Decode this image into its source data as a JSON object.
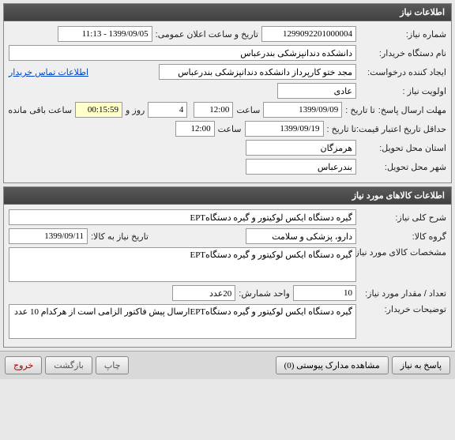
{
  "panel1": {
    "title": "اطلاعات نیاز",
    "reqno_label": "شماره نیاز:",
    "reqno": "1299092201000004",
    "announce_label": "تاریخ و ساعت اعلان عمومی:",
    "announce_value": "1399/09/05 - 11:13",
    "buyer_label": "نام دستگاه خریدار:",
    "buyer": "دانشکده دندانپزشکی بندرعباس",
    "requester_label": "ایجاد کننده درخواست:",
    "requester": "مجد ختو کارپرداز دانشکده دندانپزشکی بندرعباس",
    "contact_link": "اطلاعات تماس خریدار",
    "priority_label": "اولویت نیاز :",
    "priority": "عادی",
    "deadline_label": "مهلت ارسال پاسخ:",
    "until_label": "تا تاریخ :",
    "deadline_date": "1399/09/09",
    "time_label": "ساعت",
    "deadline_time": "12:00",
    "days_value": "4",
    "days_label": "روز و",
    "countdown": "00:15:59",
    "remaining_label": "ساعت باقی مانده",
    "valid_label": "حداقل تاریخ اعتبار قیمت:",
    "valid_until_label": "تا تاریخ :",
    "valid_date": "1399/09/19",
    "valid_time": "12:00",
    "province_label": "استان محل تحویل:",
    "province": "هرمزگان",
    "city_label": "شهر محل تحویل:",
    "city": "بندرعباس"
  },
  "panel2": {
    "title": "اطلاعات کالاهای مورد نیاز",
    "desc_label": "شرح کلی نیاز:",
    "desc": "گیره دستگاه ایکس لوکیتور و گیره دستگاهEPT",
    "group_label": "گروه کالا:",
    "group": "دارو، پزشکی و سلامت",
    "need_date_label": "تاریخ نیاز به کالا:",
    "need_date": "1399/09/11",
    "spec_label": "مشخصات کالای مورد نیاز:",
    "spec": "گیره دستگاه ایکس لوکیتور و گیره دستگاهEPT",
    "qty_label": "تعداد / مقدار مورد نیاز:",
    "qty": "10",
    "unit_label": "واحد شمارش:",
    "unit": "20عدد",
    "notes_label": "توضیحات خریدار:",
    "notes": "گیره دستگاه ایکس لوکیتور و گیره دستگاهEPTارسال پیش فاکتور الزامی است از هرکدام 10 عدد"
  },
  "buttons": {
    "respond": "پاسخ به نیاز",
    "attachments": "مشاهده مدارک پیوستی (0)",
    "print": "چاپ",
    "back": "بازگشت",
    "exit": "خروج"
  }
}
